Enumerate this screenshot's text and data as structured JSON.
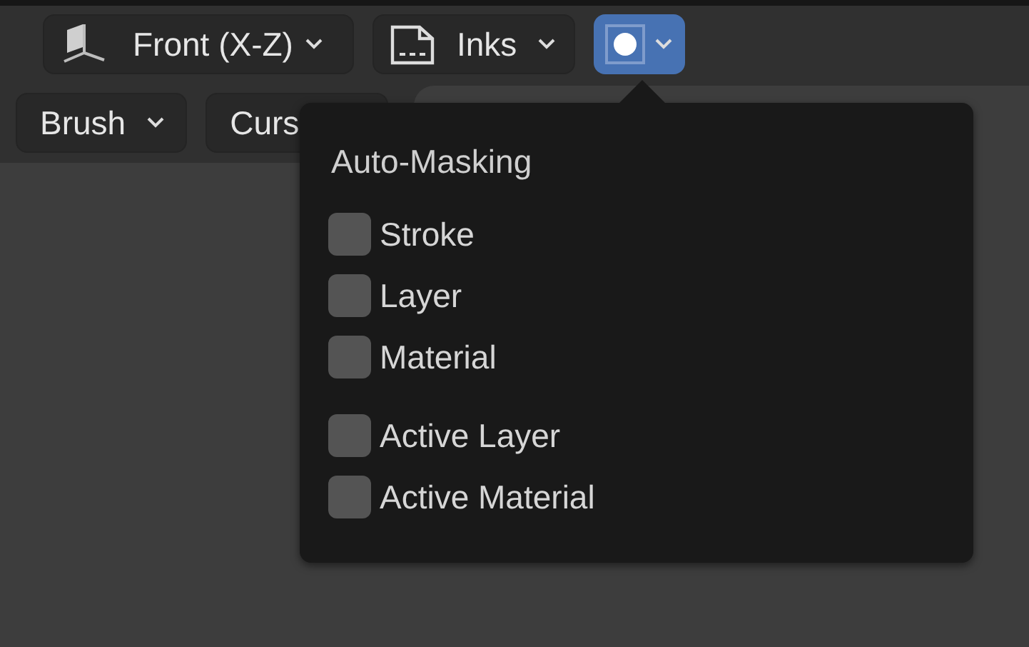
{
  "header": {
    "view_menu": {
      "label": "Front (X-Z)"
    },
    "layer_menu": {
      "label": "Inks"
    },
    "mode_button": {
      "selected": true
    }
  },
  "toolbar": {
    "items": [
      {
        "label": "Brush"
      },
      {
        "label": "Curs"
      }
    ]
  },
  "popup": {
    "title": "Auto-Masking",
    "groups": [
      [
        {
          "label": "Stroke",
          "checked": false
        },
        {
          "label": "Layer",
          "checked": false
        },
        {
          "label": "Material",
          "checked": false
        }
      ],
      [
        {
          "label": "Active Layer",
          "checked": false
        },
        {
          "label": "Active Material",
          "checked": false
        }
      ]
    ]
  }
}
